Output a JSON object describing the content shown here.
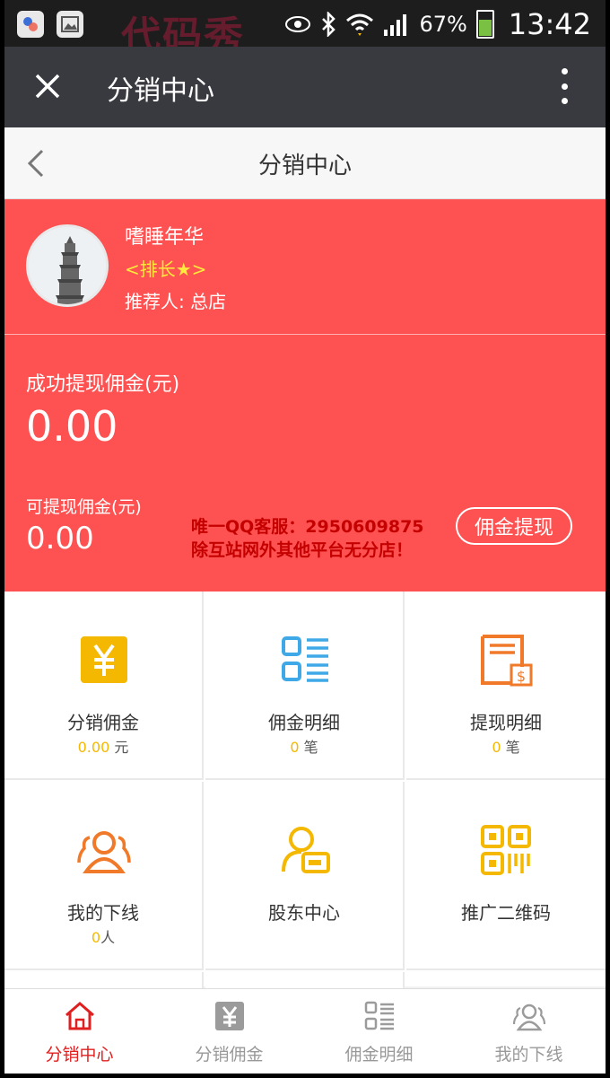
{
  "status_bar": {
    "battery": "67%",
    "time": "13:42",
    "watermark": "代码秀"
  },
  "titlebar": {
    "title": "分销中心"
  },
  "navbar": {
    "title": "分销中心"
  },
  "profile": {
    "name": "嗜睡年华",
    "rank": "<排长★>",
    "referrer": "推荐人: 总店"
  },
  "earnings": {
    "success_label": "成功提现佣金(元)",
    "success_value": "0.00",
    "available_label": "可提现佣金(元)",
    "available_value": "0.00",
    "withdraw_button": "佣金提现"
  },
  "promo": {
    "line1": "唯一QQ客服：2950609875",
    "line2": "除互站网外其他平台无分店！"
  },
  "grid": [
    {
      "label": "分销佣金",
      "value": "0.00",
      "unit": "元",
      "icon": "yuan-icon"
    },
    {
      "label": "佣金明细",
      "value": "0",
      "unit": "笔",
      "icon": "list-icon"
    },
    {
      "label": "提现明细",
      "value": "0",
      "unit": "笔",
      "icon": "withdraw-record-icon"
    },
    {
      "label": "我的下线",
      "value": "0",
      "unit": "人",
      "icon": "team-icon"
    },
    {
      "label": "股东中心",
      "icon": "shareholder-icon"
    },
    {
      "label": "推广二维码",
      "icon": "qrcode-icon"
    }
  ],
  "tabs": [
    {
      "label": "分销中心",
      "icon": "home-icon",
      "active": true
    },
    {
      "label": "分销佣金",
      "icon": "yuan-icon"
    },
    {
      "label": "佣金明细",
      "icon": "list-icon"
    },
    {
      "label": "我的下线",
      "icon": "team-icon"
    }
  ],
  "colors": {
    "header_red": "#fe5151",
    "accent_yellow": "#f5b800",
    "rank_yellow": "#ffeb3b",
    "icon_blue": "#3fa9e8",
    "icon_orange": "#f07a2a",
    "active_tab": "#e02020"
  }
}
